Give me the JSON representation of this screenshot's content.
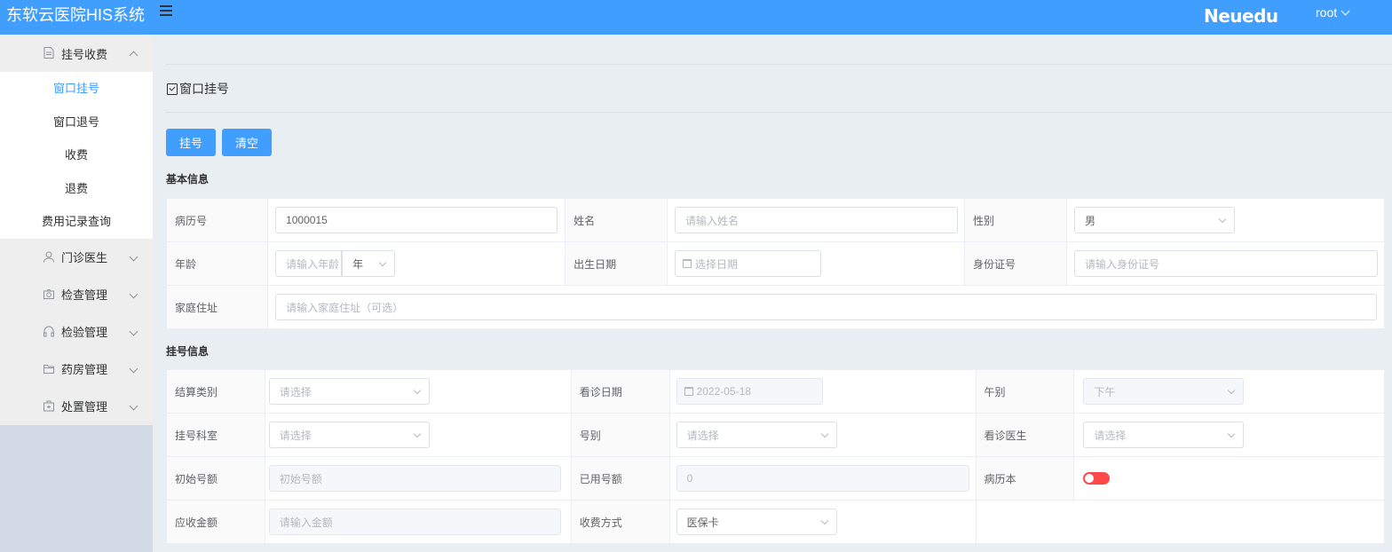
{
  "header": {
    "app_title": "东软云医院HIS系统",
    "brand": "Neuedu",
    "user": "root"
  },
  "sidebar": {
    "groups": [
      {
        "label": "挂号收费",
        "icon": "document-icon",
        "expanded": true,
        "items": [
          "窗口挂号",
          "窗口退号",
          "收费",
          "退费",
          "费用记录查询"
        ],
        "active_index": 0
      },
      {
        "label": "门诊医生",
        "icon": "user-icon"
      },
      {
        "label": "检查管理",
        "icon": "camera-icon"
      },
      {
        "label": "检验管理",
        "icon": "headset-icon"
      },
      {
        "label": "药房管理",
        "icon": "folder-icon"
      },
      {
        "label": "处置管理",
        "icon": "first-aid-icon"
      }
    ]
  },
  "page": {
    "title": "窗口挂号"
  },
  "actions": {
    "register": "挂号",
    "clear": "清空"
  },
  "basic": {
    "section": "基本信息",
    "record_no_label": "病历号",
    "record_no_value": "1000015",
    "name_label": "姓名",
    "name_placeholder": "请输入姓名",
    "gender_label": "性别",
    "gender_value": "男",
    "age_label": "年龄",
    "age_placeholder": "请输入年龄",
    "age_unit": "年",
    "birth_label": "出生日期",
    "birth_placeholder": "选择日期",
    "id_label": "身份证号",
    "id_placeholder": "请输入身份证号",
    "address_label": "家庭住址",
    "address_placeholder": "请输入家庭住址（可选）"
  },
  "registration": {
    "section": "挂号信息",
    "settle_label": "结算类别",
    "settle_placeholder": "请选择",
    "visit_date_label": "看诊日期",
    "visit_date_value": "2022-05-18",
    "noon_label": "午别",
    "noon_value": "下午",
    "dept_label": "挂号科室",
    "dept_placeholder": "请选择",
    "level_label": "号别",
    "level_placeholder": "请选择",
    "doctor_label": "看诊医生",
    "doctor_placeholder": "请选择",
    "init_quota_label": "初始号额",
    "init_quota_placeholder": "初始号额",
    "used_quota_label": "已用号额",
    "used_quota_value": "0",
    "record_book_label": "病历本",
    "record_book_on": false,
    "amount_label": "应收金额",
    "amount_placeholder": "请输入金额",
    "pay_method_label": "收费方式",
    "pay_method_value": "医保卡"
  },
  "colors": {
    "primary": "#409eff",
    "switch_off": "#ff4949"
  }
}
